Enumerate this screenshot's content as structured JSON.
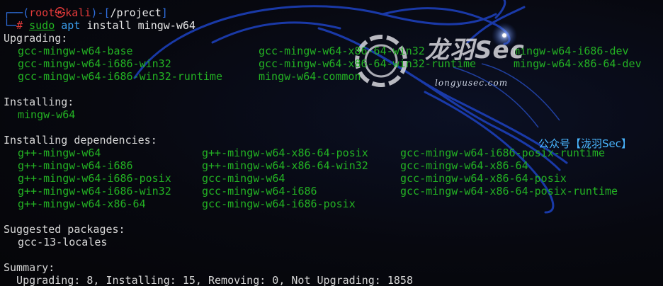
{
  "prompt": {
    "frame_top": "┌──(",
    "user": "root",
    "at": "㉿",
    "host": "kali",
    "sep": ")-[",
    "cwd": "/project",
    "close": "]",
    "frame_bottom": "└─",
    "symbol": "# ",
    "cmd_sudo": "sudo",
    "cmd_apt": "apt",
    "cmd_rest": " install mingw-w64"
  },
  "upgrading": {
    "heading": "Upgrading:",
    "rows": [
      [
        "gcc-mingw-w64-base",
        "gcc-mingw-w64-x86-64-win32",
        "mingw-w64-i686-dev"
      ],
      [
        "gcc-mingw-w64-i686-win32",
        "gcc-mingw-w64-x86-64-win32-runtime",
        "mingw-w64-x86-64-dev"
      ],
      [
        "gcc-mingw-w64-i686-win32-runtime",
        "mingw-w64-common",
        ""
      ]
    ]
  },
  "installing": {
    "heading": "Installing:",
    "items": [
      "mingw-w64"
    ]
  },
  "dependencies": {
    "heading": "Installing dependencies:",
    "rows": [
      [
        "g++-mingw-w64",
        "g++-mingw-w64-x86-64-posix",
        "gcc-mingw-w64-i686-posix-runtime"
      ],
      [
        "g++-mingw-w64-i686",
        "g++-mingw-w64-x86-64-win32",
        "gcc-mingw-w64-x86-64"
      ],
      [
        "g++-mingw-w64-i686-posix",
        "gcc-mingw-w64",
        "gcc-mingw-w64-x86-64-posix"
      ],
      [
        "g++-mingw-w64-i686-win32",
        "gcc-mingw-w64-i686",
        "gcc-mingw-w64-x86-64-posix-runtime"
      ],
      [
        "g++-mingw-w64-x86-64",
        "gcc-mingw-w64-i686-posix",
        ""
      ]
    ]
  },
  "suggested": {
    "heading": "Suggested packages:",
    "items": [
      "gcc-13-locales"
    ]
  },
  "summary": {
    "heading": "Summary:",
    "text": "  Upgrading: 8, Installing: 15, Removing: 0, Not Upgrading: 1858"
  },
  "watermark": {
    "logo_text": "龙羽Sec",
    "url": "longyusec.com",
    "wechat": "公众号【泷羽Sec】"
  },
  "colors": {
    "package_green": "#23b223",
    "prompt_blue": "#2f6fe0",
    "prompt_red": "#e23a3a",
    "watermark_blue": "#4ab6ff"
  }
}
